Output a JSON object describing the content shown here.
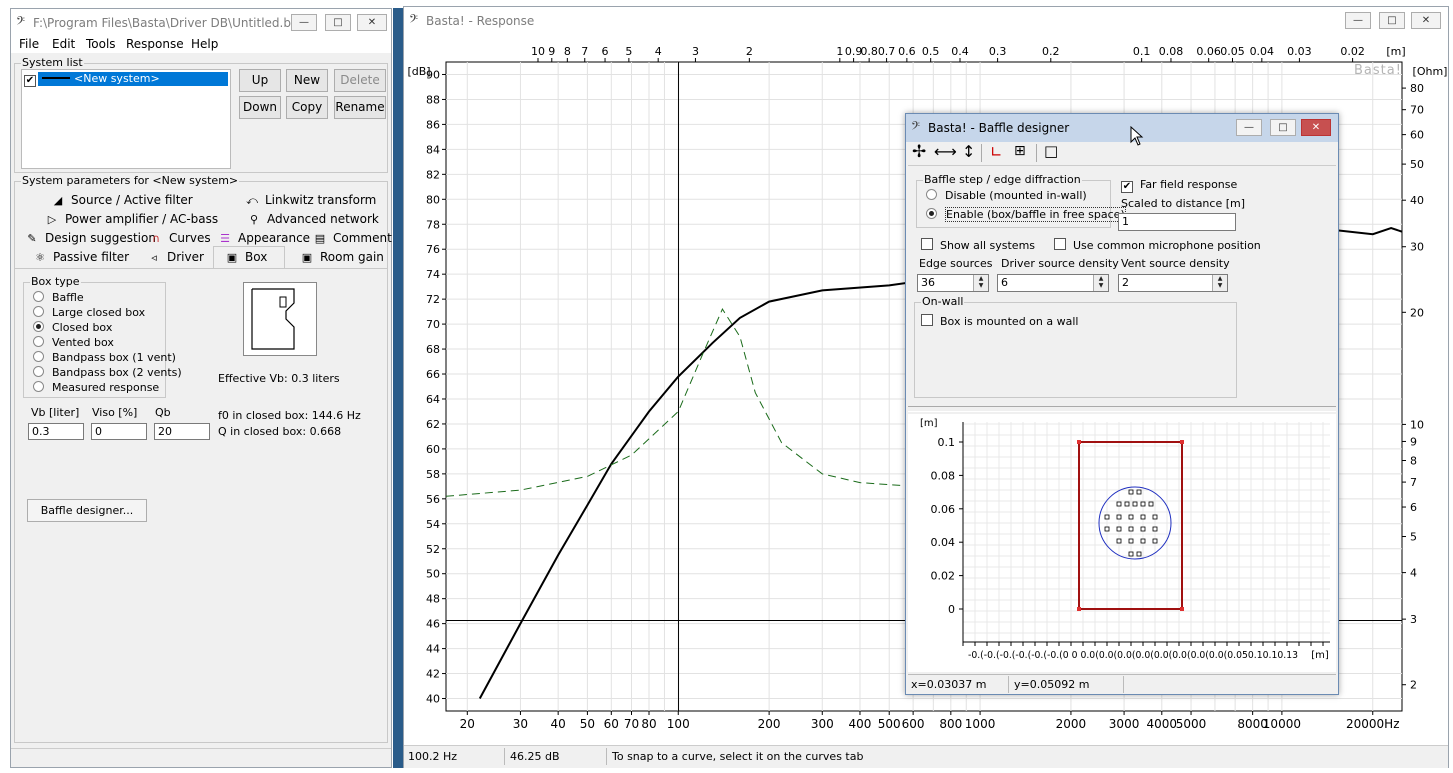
{
  "left_window": {
    "title": "F:\\Program Files\\Basta\\Driver DB\\Untitled.bas...",
    "menu": [
      "File",
      "Edit",
      "Tools",
      "Response",
      "Help"
    ],
    "system_list_label": "System list",
    "system_item": "<New system>",
    "buttons": {
      "up": "Up",
      "new": "New",
      "delete": "Delete",
      "down": "Down",
      "copy": "Copy",
      "rename": "Rename"
    },
    "params_label": "System parameters for <New system>",
    "tabs": {
      "source": "Source / Active filter",
      "linkwitz": "Linkwitz transform",
      "power": "Power amplifier / AC-bass",
      "advanced": "Advanced network",
      "design": "Design suggestion",
      "curves": "Curves",
      "appearance": "Appearance",
      "comment": "Comment",
      "passive": "Passive filter",
      "driver": "Driver",
      "box": "Box",
      "room": "Room gain"
    },
    "box_type_label": "Box type",
    "box_types": [
      "Baffle",
      "Large closed box",
      "Closed box",
      "Vented box",
      "Bandpass box (1 vent)",
      "Bandpass box (2 vents)",
      "Measured response"
    ],
    "selected_box_type": "Closed box",
    "effective_vb": "Effective Vb: 0.3 liters",
    "vb_label": "Vb [liter]",
    "viso_label": "Viso [%]",
    "qb_label": "Qb",
    "vb_value": "0.3",
    "viso_value": "0",
    "qb_value": "20",
    "f0_text": "f0 in closed box: 144.6 Hz",
    "q_text": "Q  in closed box: 0.668",
    "baffle_button": "Baffle designer..."
  },
  "response_window": {
    "title": "Basta! - Response",
    "watermark": "Basta!",
    "ylabel": "[dB]",
    "y2label": "[Ohm]",
    "xunit_top": "[m]",
    "status": {
      "freq": "100.2 Hz",
      "level": "46.25 dB",
      "hint": "To snap to a curve, select it on the curves tab"
    }
  },
  "baffle_window": {
    "title": "Basta! - Baffle designer",
    "group_label": "Baffle step / edge diffraction",
    "radio_disable": "Disable (mounted in-wall)",
    "radio_enable": "Enable (box/baffle in free space)",
    "far_field": "Far field response",
    "scaled_label": "Scaled to distance [m]",
    "scaled_value": "1",
    "show_all": "Show all systems",
    "common_mic": "Use common microphone position",
    "edge_label": "Edge sources",
    "edge_value": "36",
    "driver_density_label": "Driver source density",
    "driver_density_value": "6",
    "vent_density_label": "Vent source density",
    "vent_density_value": "2",
    "onwall_label": "On-wall",
    "onwall_check": "Box is mounted on a wall",
    "plot_unit": "[m]",
    "plot_yticks": [
      "0.1",
      "0.08",
      "0.06",
      "0.04",
      "0.02",
      "0"
    ],
    "plot_xticks_text": "-0.(-0.(-0.(-0.(-0.(-0.(0  0  0.0(0.0(0.0(0.0(0.0(0.0(0.0(0.0(0.050.10.10.13",
    "status_x": "x=0.03037 m",
    "status_y": "y=0.05092 m"
  },
  "chart_data": {
    "type": "line",
    "xscale": "log",
    "xlim": [
      17,
      25000
    ],
    "ylim": [
      39,
      91
    ],
    "ylabel": "[dB]",
    "y2label": "[Ohm]",
    "x_ticks": [
      20,
      30,
      40,
      50,
      60,
      70,
      80,
      100,
      200,
      300,
      400,
      500,
      600,
      800,
      1000,
      2000,
      3000,
      4000,
      5000,
      8000,
      10000,
      20000
    ],
    "x_tick_labels": [
      "20",
      "30",
      "40",
      "50",
      "60",
      "70",
      "80",
      "100",
      "200",
      "300",
      "400",
      "500",
      "600",
      "800",
      "1000",
      "2000",
      "3000",
      "4000",
      "5000",
      "8000",
      "10000",
      "20000Hz"
    ],
    "y_ticks": [
      40,
      42,
      44,
      46,
      48,
      50,
      52,
      54,
      56,
      58,
      60,
      62,
      64,
      66,
      68,
      70,
      72,
      74,
      76,
      78,
      80,
      82,
      84,
      86,
      88,
      90
    ],
    "top_ticks": [
      {
        "f": 34.3,
        "label": "10"
      },
      {
        "f": 38.1,
        "label": "9"
      },
      {
        "f": 42.9,
        "label": "8"
      },
      {
        "f": 49,
        "label": "7"
      },
      {
        "f": 57.2,
        "label": "6"
      },
      {
        "f": 68.6,
        "label": "5"
      },
      {
        "f": 85.8,
        "label": "4"
      },
      {
        "f": 114,
        "label": "3"
      },
      {
        "f": 172,
        "label": "2"
      },
      {
        "f": 343,
        "label": "1"
      },
      {
        "f": 381,
        "label": "0.9"
      },
      {
        "f": 429,
        "label": "0.8"
      },
      {
        "f": 490,
        "label": "0.7"
      },
      {
        "f": 572,
        "label": "0.6"
      },
      {
        "f": 686,
        "label": "0.5"
      },
      {
        "f": 858,
        "label": "0.4"
      },
      {
        "f": 1143,
        "label": "0.3"
      },
      {
        "f": 1715,
        "label": "0.2"
      },
      {
        "f": 3430,
        "label": "0.1"
      },
      {
        "f": 4290,
        "label": "0.08"
      },
      {
        "f": 5720,
        "label": "0.06"
      },
      {
        "f": 6860,
        "label": "0.05"
      },
      {
        "f": 8580,
        "label": "0.04"
      },
      {
        "f": 11430,
        "label": "0.03"
      },
      {
        "f": 17150,
        "label": "0.02"
      }
    ],
    "ohm_ticks": [
      {
        "v": 80,
        "label": "80"
      },
      {
        "v": 70,
        "label": "70"
      },
      {
        "v": 60,
        "label": "60"
      },
      {
        "v": 50,
        "label": "50"
      },
      {
        "v": 40,
        "label": "40"
      },
      {
        "v": 30,
        "label": "30"
      },
      {
        "v": 20,
        "label": "20"
      },
      {
        "v": 10,
        "label": "10"
      },
      {
        "v": 9,
        "label": "9"
      },
      {
        "v": 8,
        "label": "8"
      },
      {
        "v": 7,
        "label": "7"
      },
      {
        "v": 6,
        "label": "6"
      },
      {
        "v": 5,
        "label": "5"
      },
      {
        "v": 4,
        "label": "4"
      },
      {
        "v": 3,
        "label": "3"
      },
      {
        "v": 2,
        "label": "2"
      }
    ],
    "cursor": {
      "x": 100.2,
      "y": 46.25
    },
    "series": [
      {
        "points": [
          [
            22,
            40
          ],
          [
            30,
            46
          ],
          [
            40,
            51.5
          ],
          [
            50,
            55.5
          ],
          [
            60,
            58.8
          ],
          [
            80,
            63
          ],
          [
            100,
            65.8
          ],
          [
            130,
            68.5
          ],
          [
            160,
            70.5
          ],
          [
            200,
            71.8
          ],
          [
            300,
            72.7
          ],
          [
            500,
            73.1
          ],
          [
            700,
            73.6
          ],
          [
            1000,
            74.3
          ],
          [
            2000,
            76
          ],
          [
            5000,
            77.5
          ],
          [
            10000,
            78
          ],
          [
            20000,
            77.2
          ],
          [
            23000,
            77.7
          ],
          [
            25000,
            77.4
          ]
        ]
      },
      {
        "points": [
          [
            17,
            56.2
          ],
          [
            30,
            56.7
          ],
          [
            50,
            57.8
          ],
          [
            70,
            59.5
          ],
          [
            100,
            63
          ],
          [
            120,
            67.5
          ],
          [
            140,
            71.2
          ],
          [
            160,
            69
          ],
          [
            180,
            64.5
          ],
          [
            220,
            60.5
          ],
          [
            300,
            58
          ],
          [
            400,
            57.3
          ],
          [
            600,
            57
          ]
        ]
      }
    ]
  }
}
